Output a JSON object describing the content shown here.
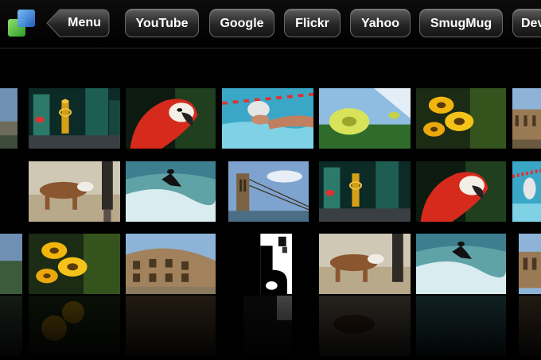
{
  "toolbar": {
    "app_icon": "gallery-app-icon",
    "menu_label": "Menu",
    "bookmarks": [
      "YouTube",
      "Google",
      "Flickr",
      "Yahoo",
      "SmugMug",
      "Dev"
    ]
  },
  "gallery": {
    "photos": [
      "landscape",
      "peace-sign-city",
      "red-parrot",
      "swimmer",
      "yellow-flower",
      "sunflowers",
      "colosseum",
      "dog-on-beach",
      "surfer",
      "brooklyn-bridge",
      "peace-sign-city",
      "red-parrot",
      "swimmer",
      "landscape",
      "sunflowers",
      "colosseum",
      "abstract-bw",
      "dog-on-beach",
      "surfer",
      "colosseum"
    ]
  },
  "colors": {
    "background": "#000000",
    "pill_border": "#6a6a6a",
    "text": "#ffffff"
  }
}
